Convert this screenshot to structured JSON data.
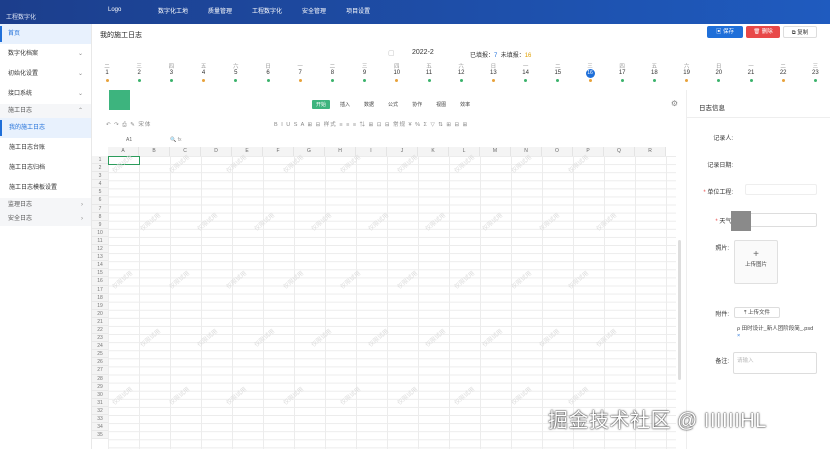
{
  "topbar": {
    "left_text": "工程数字化",
    "logo_text": "Logo",
    "nav": [
      "数字化工地",
      "质量管理",
      "工程数字化",
      "安全管理",
      "项目设置"
    ]
  },
  "sidebar": {
    "items": [
      {
        "label": "首页",
        "arrow": ""
      },
      {
        "label": "数字化档案",
        "arrow": "⌄"
      },
      {
        "label": "初始化设置",
        "arrow": "⌄"
      },
      {
        "label": "接口系统",
        "arrow": "⌄"
      }
    ],
    "group1": {
      "label": "施工日志",
      "arrow": "⌃"
    },
    "sub": [
      "我的施工日志",
      "施工日志台账",
      "施工日志归档",
      "施工日志模板设置"
    ],
    "group2": {
      "label": "监理日志",
      "arrow": "›"
    },
    "group3": {
      "label": "安全日志",
      "arrow": "›"
    }
  },
  "page": {
    "title": "我的施工日志",
    "save": "保存",
    "delete": "删除",
    "copy": "复制"
  },
  "datebar": {
    "month": "2022-2",
    "filled_label": "已填报：",
    "filled_count": "7",
    "unfilled_label": "未填报：",
    "unfilled_count": "16",
    "days": [
      {
        "w": "二",
        "n": "1"
      },
      {
        "w": "三",
        "n": "2"
      },
      {
        "w": "四",
        "n": "3"
      },
      {
        "w": "五",
        "n": "4"
      },
      {
        "w": "六",
        "n": "5"
      },
      {
        "w": "日",
        "n": "6"
      },
      {
        "w": "一",
        "n": "7"
      },
      {
        "w": "二",
        "n": "8"
      },
      {
        "w": "三",
        "n": "9"
      },
      {
        "w": "四",
        "n": "10"
      },
      {
        "w": "五",
        "n": "11"
      },
      {
        "w": "六",
        "n": "12"
      },
      {
        "w": "日",
        "n": "13"
      },
      {
        "w": "一",
        "n": "14"
      },
      {
        "w": "二",
        "n": "15"
      },
      {
        "w": "三",
        "n": "16"
      },
      {
        "w": "四",
        "n": "17"
      },
      {
        "w": "五",
        "n": "18"
      },
      {
        "w": "六",
        "n": "19"
      },
      {
        "w": "日",
        "n": "20"
      },
      {
        "w": "一",
        "n": "21"
      },
      {
        "w": "二",
        "n": "22"
      },
      {
        "w": "三",
        "n": "23"
      }
    ],
    "current_day": "16"
  },
  "sheet": {
    "tabs": [
      "开始",
      "插入",
      "数据",
      "公式",
      "协作",
      "视图",
      "效率"
    ],
    "active_tab": "开始",
    "toolbar_text": "↶ ↷ ⎙ ✎   宋体",
    "toolbar_text2": "B I U S A ⊞ ⊟ 样式 ≡ ≡ ≡ ⇅ ⊞ ⊡ ⊟ 常规 ¥ % Σ ▽ ⇅ ⊞ ⊟ ⊞",
    "cell_ref": "A1",
    "columns": [
      "A",
      "B",
      "C",
      "D",
      "E",
      "F",
      "G",
      "H",
      "I",
      "J",
      "K",
      "L",
      "M",
      "N",
      "O",
      "P",
      "Q",
      "R"
    ],
    "rows": 35,
    "watermark": "仅限试用"
  },
  "panel": {
    "title": "日志信息",
    "recorder_label": "记录人:",
    "date_label": "记录日期:",
    "unit_label": "单位工程:",
    "weather_label": "天气:",
    "photo_label": "照片:",
    "upload_photo": "上传图片",
    "attach_label": "附件:",
    "upload_file": "上传文件",
    "file_name": "ρ 田时设计_新人团阶段简_.psd",
    "file_remove": "×",
    "remark_label": "备注:",
    "remark_placeholder": "请输入"
  },
  "watermark_text": "掘金技术社区 @ IIIIIIHL"
}
